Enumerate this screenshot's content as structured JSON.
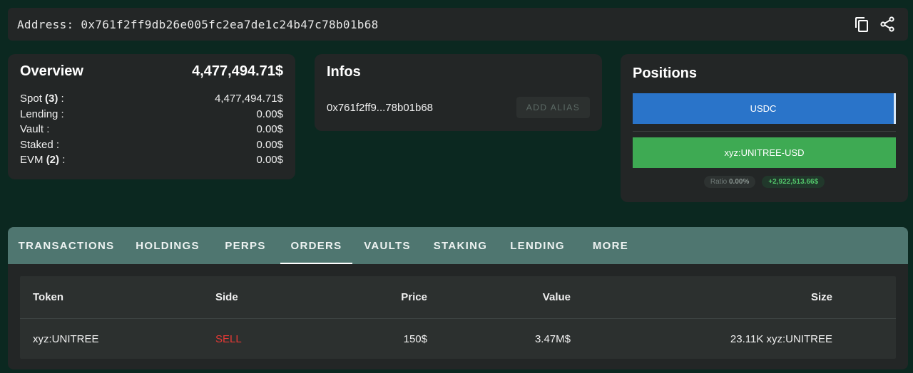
{
  "address_bar": {
    "label": "Address: 0x761f2ff9db26e005fc2ea7de1c24b47c78b01b68",
    "icons": [
      "copy-icon",
      "share-icon"
    ]
  },
  "overview": {
    "title": "Overview",
    "total": "4,477,494.71$",
    "rows": [
      {
        "label": "Spot ",
        "count": "(3)",
        "suffix": " :",
        "value": "4,477,494.71$"
      },
      {
        "label": "Lending :",
        "count": "",
        "suffix": "",
        "value": "0.00$"
      },
      {
        "label": "Vault :",
        "count": "",
        "suffix": "",
        "value": "0.00$"
      },
      {
        "label": "Staked :",
        "count": "",
        "suffix": "",
        "value": "0.00$"
      },
      {
        "label": "EVM ",
        "count": "(2)",
        "suffix": " :",
        "value": "0.00$"
      }
    ]
  },
  "infos": {
    "title": "Infos",
    "short_address": "0x761f2ff9...78b01b68",
    "add_alias": "ADD ALIAS"
  },
  "positions": {
    "title": "Positions",
    "bars": [
      "USDC",
      "xyz:UNITREE-USD"
    ],
    "ratio_label": "Ratio",
    "ratio_value": "0.00%",
    "pnl": "+2,922,513.66$",
    "colors": {
      "usdc": "#2a74c9",
      "xyz": "#3eaa53"
    }
  },
  "tabs": [
    "TRANSACTIONS",
    "HOLDINGS",
    "PERPS",
    "ORDERS",
    "VAULTS",
    "STAKING",
    "LENDING",
    "MORE"
  ],
  "active_tab": "ORDERS",
  "orders_table": {
    "headers": [
      "Token",
      "Side",
      "Price",
      "Value",
      "Size"
    ],
    "rows": [
      {
        "token": "xyz:UNITREE",
        "side": "SELL",
        "price": "150$",
        "value": "3.47M$",
        "size": "23.11K xyz:UNITREE"
      }
    ]
  }
}
